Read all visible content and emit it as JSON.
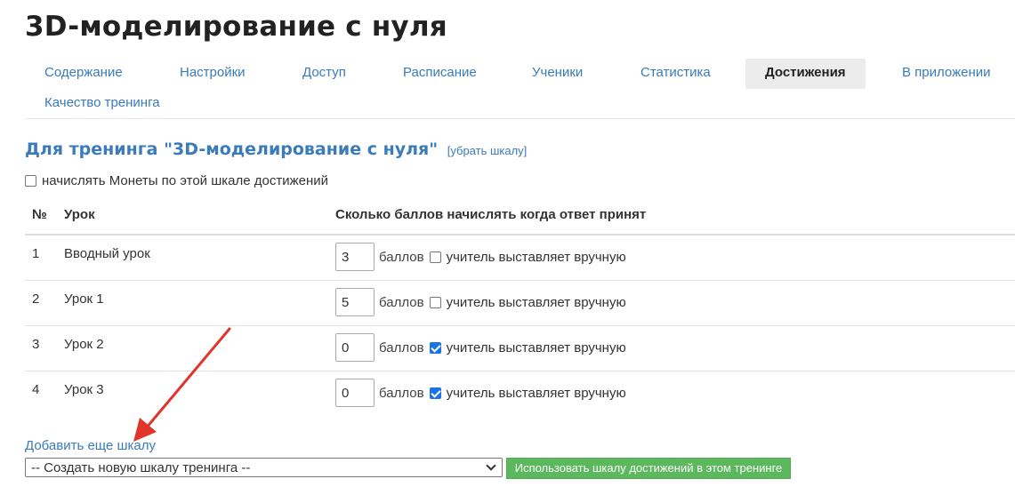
{
  "page": {
    "title": "3D-моделирование с нуля"
  },
  "tabs": [
    {
      "label": "Содержание",
      "active": false
    },
    {
      "label": "Настройки",
      "active": false
    },
    {
      "label": "Доступ",
      "active": false
    },
    {
      "label": "Расписание",
      "active": false
    },
    {
      "label": "Ученики",
      "active": false
    },
    {
      "label": "Статистика",
      "active": false
    },
    {
      "label": "Достижения",
      "active": true
    },
    {
      "label": "В приложении",
      "active": false
    },
    {
      "label": "Качество тренинга",
      "active": false
    }
  ],
  "scale": {
    "title": "Для тренинга \"3D-моделирование с нуля\"",
    "remove_link": "[убрать шкалу]",
    "coins_label": "начислять Монеты по этой шкале достижений",
    "coins_checked": false
  },
  "table": {
    "headers": {
      "num": "№",
      "lesson": "Урок",
      "points": "Сколько баллов начислять когда ответ принят"
    },
    "unit_label": "баллов",
    "manual_label": "учитель выставляет вручную",
    "rows": [
      {
        "num": "1",
        "lesson": "Вводный урок",
        "points": "3",
        "manual": false
      },
      {
        "num": "2",
        "lesson": "Урок 1",
        "points": "5",
        "manual": false
      },
      {
        "num": "3",
        "lesson": "Урок 2",
        "points": "0",
        "manual": true
      },
      {
        "num": "4",
        "lesson": "Урок 3",
        "points": "0",
        "manual": true
      }
    ]
  },
  "footer": {
    "add_scale_label": "Добавить еще шкалу",
    "select_value": "-- Создать новую шкалу тренинга --",
    "use_button_label": "Использовать шкалу достижений в этом тренинге"
  },
  "colors": {
    "link": "#3a7bb8",
    "active_tab_bg": "#ececec",
    "button_green": "#5cb85c",
    "checkbox_checked": "#1a73e8",
    "annotation_arrow": "#e0352b"
  }
}
